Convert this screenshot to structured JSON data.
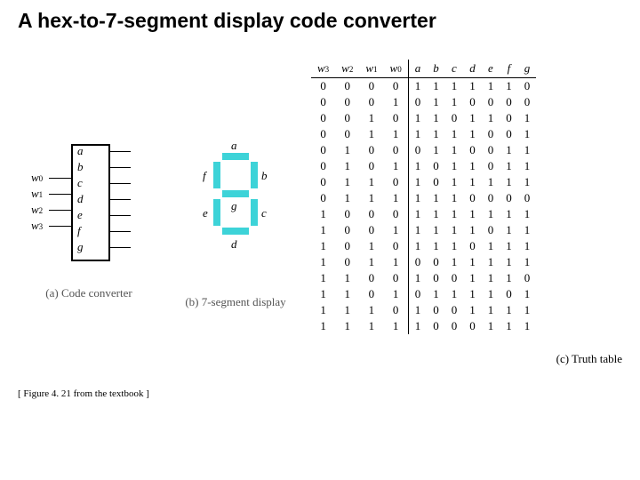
{
  "title": "A hex-to-7-segment display code converter",
  "converter": {
    "inputs": [
      "w0",
      "w1",
      "w2",
      "w3"
    ],
    "outputs": [
      "a",
      "b",
      "c",
      "d",
      "e",
      "f",
      "g"
    ],
    "caption": "(a) Code converter"
  },
  "segdisp": {
    "labels": {
      "a": "a",
      "b": "b",
      "c": "c",
      "d": "d",
      "e": "e",
      "f": "f",
      "g": "g"
    },
    "caption": "(b) 7-segment display"
  },
  "truth": {
    "in_headers": [
      "w3",
      "w2",
      "w1",
      "w0"
    ],
    "out_headers": [
      "a",
      "b",
      "c",
      "d",
      "e",
      "f",
      "g"
    ],
    "rows": [
      {
        "in": [
          0,
          0,
          0,
          0
        ],
        "out": [
          1,
          1,
          1,
          1,
          1,
          1,
          0
        ]
      },
      {
        "in": [
          0,
          0,
          0,
          1
        ],
        "out": [
          0,
          1,
          1,
          0,
          0,
          0,
          0
        ]
      },
      {
        "in": [
          0,
          0,
          1,
          0
        ],
        "out": [
          1,
          1,
          0,
          1,
          1,
          0,
          1
        ]
      },
      {
        "in": [
          0,
          0,
          1,
          1
        ],
        "out": [
          1,
          1,
          1,
          1,
          0,
          0,
          1
        ]
      },
      {
        "in": [
          0,
          1,
          0,
          0
        ],
        "out": [
          0,
          1,
          1,
          0,
          0,
          1,
          1
        ]
      },
      {
        "in": [
          0,
          1,
          0,
          1
        ],
        "out": [
          1,
          0,
          1,
          1,
          0,
          1,
          1
        ]
      },
      {
        "in": [
          0,
          1,
          1,
          0
        ],
        "out": [
          1,
          0,
          1,
          1,
          1,
          1,
          1
        ]
      },
      {
        "in": [
          0,
          1,
          1,
          1
        ],
        "out": [
          1,
          1,
          1,
          0,
          0,
          0,
          0
        ]
      },
      {
        "in": [
          1,
          0,
          0,
          0
        ],
        "out": [
          1,
          1,
          1,
          1,
          1,
          1,
          1
        ]
      },
      {
        "in": [
          1,
          0,
          0,
          1
        ],
        "out": [
          1,
          1,
          1,
          1,
          0,
          1,
          1
        ]
      },
      {
        "in": [
          1,
          0,
          1,
          0
        ],
        "out": [
          1,
          1,
          1,
          0,
          1,
          1,
          1
        ]
      },
      {
        "in": [
          1,
          0,
          1,
          1
        ],
        "out": [
          0,
          0,
          1,
          1,
          1,
          1,
          1
        ]
      },
      {
        "in": [
          1,
          1,
          0,
          0
        ],
        "out": [
          1,
          0,
          0,
          1,
          1,
          1,
          0
        ]
      },
      {
        "in": [
          1,
          1,
          0,
          1
        ],
        "out": [
          0,
          1,
          1,
          1,
          1,
          0,
          1
        ]
      },
      {
        "in": [
          1,
          1,
          1,
          0
        ],
        "out": [
          1,
          0,
          0,
          1,
          1,
          1,
          1
        ]
      },
      {
        "in": [
          1,
          1,
          1,
          1
        ],
        "out": [
          1,
          0,
          0,
          0,
          1,
          1,
          1
        ]
      }
    ],
    "caption": "(c) Truth table"
  },
  "footer": "[ Figure 4. 21 from the textbook ]"
}
